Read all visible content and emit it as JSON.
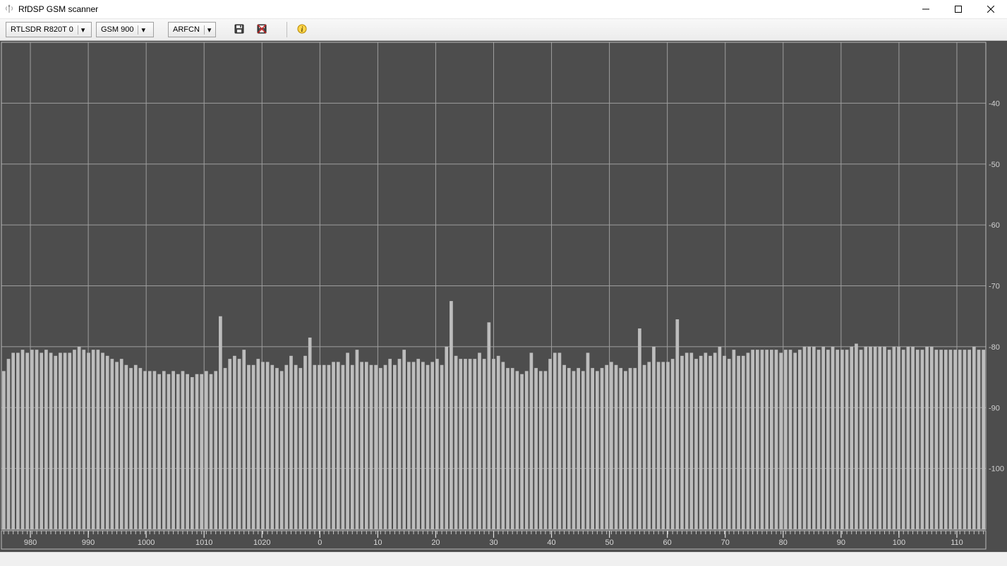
{
  "window": {
    "title": "RfDSP GSM scanner",
    "controls": {
      "minimize": "minimize",
      "maximize": "maximize",
      "close": "close"
    }
  },
  "toolbar": {
    "device_select": "RTLSDR R820T 0",
    "band_select": "GSM 900",
    "arfcn_select": "ARFCN",
    "save_icon": "save-icon",
    "clear_icon": "clear-icon",
    "info_icon": "info-icon"
  },
  "chart_data": {
    "type": "bar",
    "title": "",
    "xlabel": "",
    "ylabel": "",
    "ylim": [
      -110,
      -30
    ],
    "y_ticks": [
      -40,
      -50,
      -60,
      -70,
      -80,
      -90,
      -100
    ],
    "x_tick_labels": [
      "980",
      "990",
      "1000",
      "1010",
      "1020",
      "0",
      "10",
      "20",
      "30",
      "40",
      "50",
      "60",
      "70",
      "80",
      "90",
      "100",
      "110"
    ],
    "values": [
      -84,
      -82,
      -81,
      -81,
      -80.5,
      -81,
      -80.5,
      -80.5,
      -81,
      -80.5,
      -81,
      -81.5,
      -81,
      -81,
      -81,
      -80.5,
      -80,
      -80.5,
      -81,
      -80.5,
      -80.5,
      -81,
      -81.5,
      -82,
      -82.5,
      -82,
      -83,
      -83.5,
      -83,
      -83.5,
      -84,
      -84,
      -84,
      -84.5,
      -84,
      -84.5,
      -84,
      -84.5,
      -84,
      -84.5,
      -85,
      -84.5,
      -84.5,
      -84,
      -84.5,
      -84,
      -75,
      -83.5,
      -82,
      -81.5,
      -82,
      -80.5,
      -83,
      -83,
      -82,
      -82.5,
      -82.5,
      -83,
      -83.5,
      -84,
      -83,
      -81.5,
      -83,
      -83.5,
      -81.5,
      -78.5,
      -83,
      -83,
      -83,
      -83,
      -82.5,
      -82.5,
      -83,
      -81,
      -83,
      -80.5,
      -82.5,
      -82.5,
      -83,
      -83,
      -83.5,
      -83,
      -82,
      -83,
      -82,
      -80.5,
      -82.5,
      -82.5,
      -82,
      -82.5,
      -83,
      -82.5,
      -82,
      -83,
      -80,
      -72.5,
      -81.5,
      -82,
      -82,
      -82,
      -82,
      -81,
      -82,
      -76,
      -82,
      -81.5,
      -82.5,
      -83.5,
      -83.5,
      -84,
      -84.5,
      -84,
      -81,
      -83.5,
      -84,
      -84,
      -82,
      -81,
      -81,
      -83,
      -83.5,
      -84,
      -83.5,
      -84,
      -81,
      -83.5,
      -84,
      -83.5,
      -83,
      -82.5,
      -83,
      -83.5,
      -84,
      -83.5,
      -83.5,
      -77,
      -83,
      -82.5,
      -80,
      -82.5,
      -82.5,
      -82.5,
      -82,
      -75.5,
      -81.5,
      -81,
      -81,
      -82,
      -81.5,
      -81,
      -81.5,
      -81,
      -80,
      -81.5,
      -82,
      -80.5,
      -81.5,
      -81.5,
      -81,
      -80.5,
      -80.5,
      -80.5,
      -80.5,
      -80.5,
      -80.5,
      -81,
      -80.5,
      -80.5,
      -81,
      -80.5,
      -80,
      -80,
      -80,
      -80.5,
      -80,
      -80.5,
      -80,
      -80.5,
      -80.5,
      -80.5,
      -80,
      -79.5,
      -80.5,
      -80,
      -80,
      -80,
      -80,
      -80,
      -80.5,
      -80,
      -80,
      -80.5,
      -80,
      -80,
      -80.5,
      -80.5,
      -80,
      -80,
      -80.5,
      -80.5,
      -80.5,
      -80.5,
      -80.5,
      -80.5,
      -80.5,
      -80.5,
      -80,
      -80.5,
      -80.5
    ]
  }
}
